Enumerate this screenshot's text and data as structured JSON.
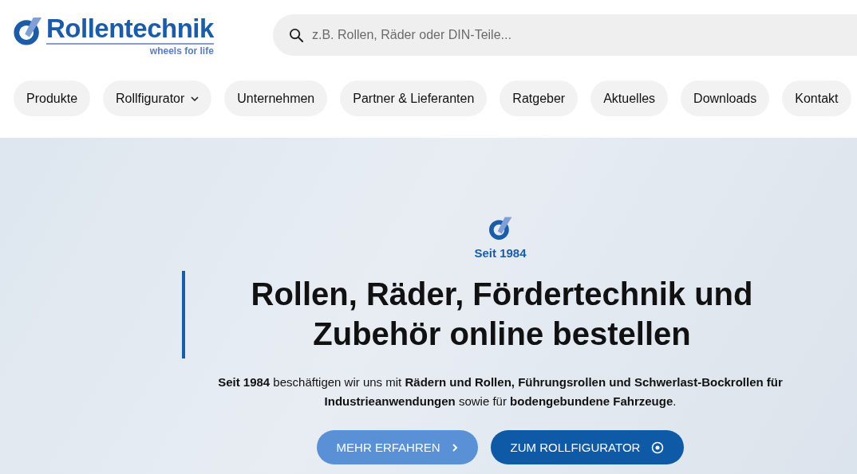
{
  "logo": {
    "name": "Rollentechnik",
    "tagline": "wheels for life"
  },
  "search": {
    "placeholder": "z.B. Rollen, Räder oder DIN-Teile..."
  },
  "nav": [
    {
      "label": "Produkte",
      "has_menu": false
    },
    {
      "label": "Rollfigurator",
      "has_menu": true
    },
    {
      "label": "Unternehmen",
      "has_menu": false
    },
    {
      "label": "Partner & Lieferanten",
      "has_menu": false
    },
    {
      "label": "Ratgeber",
      "has_menu": false
    },
    {
      "label": "Aktuelles",
      "has_menu": false
    },
    {
      "label": "Downloads",
      "has_menu": false
    },
    {
      "label": "Kontakt",
      "has_menu": false
    }
  ],
  "hero": {
    "since": "Seit 1984",
    "heading": "Rollen, Räder, Fördertechnik und Zubehör online bestellen",
    "text": "**Seit 1984** beschäftigen wir uns mit **Rädern und Rollen, Führungsrollen und Schwerlast-Bockrollen für Industrieanwendungen** sowie für **bodengebundene Fahrzeuge**.",
    "buttons": [
      {
        "label": "MEHR ERFAHREN",
        "kind": "secondary"
      },
      {
        "label": "ZUM ROLLFIGURATOR",
        "kind": "primary"
      }
    ]
  }
}
